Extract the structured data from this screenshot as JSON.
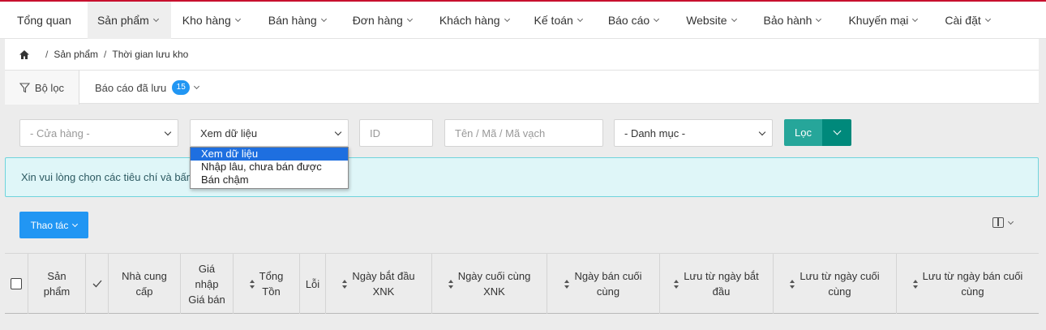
{
  "nav": {
    "items": [
      {
        "label": "Tổng quan",
        "has_caret": false,
        "active": false
      },
      {
        "label": "Sản phẩm",
        "has_caret": true,
        "active": true
      },
      {
        "label": "Kho hàng",
        "has_caret": true,
        "active": false
      },
      {
        "label": "Bán hàng",
        "has_caret": true,
        "active": false
      },
      {
        "label": "Đơn hàng",
        "has_caret": true,
        "active": false
      },
      {
        "label": "Khách hàng",
        "has_caret": true,
        "active": false
      },
      {
        "label": "Kế toán",
        "has_caret": true,
        "active": false
      },
      {
        "label": "Báo cáo",
        "has_caret": true,
        "active": false
      },
      {
        "label": "Website",
        "has_caret": true,
        "active": false
      },
      {
        "label": "Bảo hành",
        "has_caret": true,
        "active": false
      },
      {
        "label": "Khuyến mại",
        "has_caret": true,
        "active": false
      },
      {
        "label": "Cài đặt",
        "has_caret": true,
        "active": false
      }
    ]
  },
  "breadcrumb": {
    "home_icon": "home-icon",
    "sep": "/",
    "level1": "Sản phẩm",
    "level2": "Thời gian lưu kho"
  },
  "tabs": {
    "filter_label": "Bộ lọc",
    "filter_icon": "filter-icon",
    "saved_label": "Báo cáo đã lưu",
    "saved_count": "15"
  },
  "filters": {
    "store_placeholder": "- Cửa hàng -",
    "view_value": "Xem dữ liệu",
    "id_placeholder": "ID",
    "name_placeholder": "Tên / Mã / Mã vạch",
    "category_placeholder": "- Danh mục -",
    "filter_button": "Lọc"
  },
  "view_dropdown": {
    "options": [
      "Xem dữ liệu",
      "Nhập lâu, chưa bán được",
      "Bán chậm"
    ],
    "selected_index": 0
  },
  "alert": {
    "text": "Xin vui lòng chọn các tiêu chí và bấm"
  },
  "toolbar": {
    "action_label": "Thao tác",
    "columns_icon": "columns-icon"
  },
  "table": {
    "headers": [
      {
        "line1": "Sản",
        "line2": "phẩm",
        "sortable": false
      },
      {
        "line1": "Nhà cung",
        "line2": "cấp",
        "sortable": false
      },
      {
        "line1": "Giá",
        "line2": "nhập",
        "line3": "Giá bán",
        "sortable": false
      },
      {
        "line1": "Tổng",
        "line2": "Tồn",
        "sortable": true
      },
      {
        "line1": "Lỗi",
        "sortable": false
      },
      {
        "line1": "Ngày bắt đầu",
        "line2": "XNK",
        "sortable": true
      },
      {
        "line1": "Ngày cuối cùng",
        "line2": "XNK",
        "sortable": true
      },
      {
        "line1": "Ngày bán cuối",
        "line2": "cùng",
        "sortable": true
      },
      {
        "line1": "Lưu từ ngày bắt",
        "line2": "đầu",
        "sortable": true
      },
      {
        "line1": "Lưu từ ngày cuối",
        "line2": "cùng",
        "sortable": true
      },
      {
        "line1": "Lưu từ ngày bán cuối",
        "line2": "cùng",
        "sortable": true
      }
    ]
  }
}
